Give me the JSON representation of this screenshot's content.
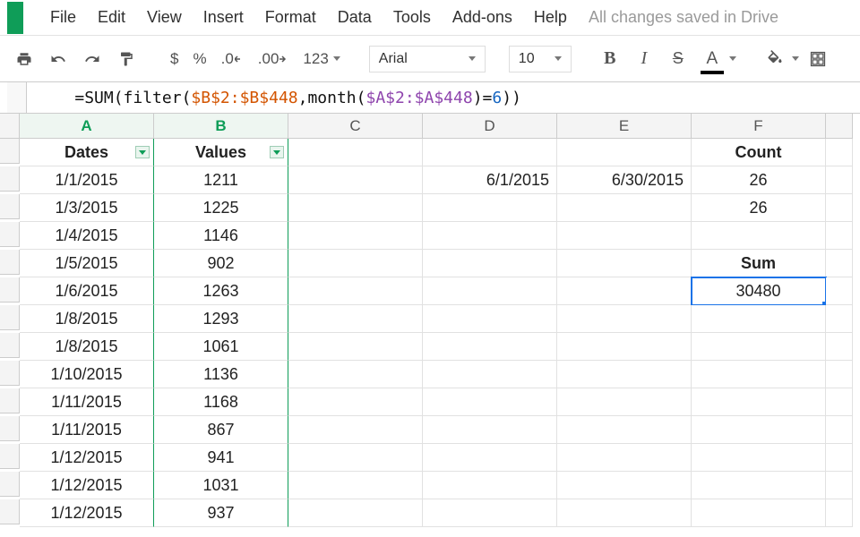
{
  "menu": [
    "File",
    "Edit",
    "View",
    "Insert",
    "Format",
    "Data",
    "Tools",
    "Add-ons",
    "Help"
  ],
  "save_status": "All changes saved in Drive",
  "toolbar": {
    "currency": "$",
    "percent": "%",
    "dec_dec": ".0",
    "inc_dec": ".00",
    "numfmt": "123",
    "font": "Arial",
    "size": "10",
    "bold": "B",
    "italic": "I",
    "strike": "S",
    "textcolor": "A"
  },
  "formula": {
    "prefix": "=SUM(filter(",
    "range1": "$B$2:$B$448",
    "mid": ",month(",
    "range2": "$A$2:$A$448",
    "mid2": ")=",
    "num": "6",
    "suffix": "))"
  },
  "columns": [
    "A",
    "B",
    "C",
    "D",
    "E",
    "F"
  ],
  "headers": {
    "A": "Dates",
    "B": "Values",
    "F": "Count"
  },
  "rows": [
    {
      "A": "1/1/2015",
      "B": "1211",
      "D": "6/1/2015",
      "E": "6/30/2015",
      "F": "26"
    },
    {
      "A": "1/3/2015",
      "B": "1225",
      "F": "26"
    },
    {
      "A": "1/4/2015",
      "B": "1146"
    },
    {
      "A": "1/5/2015",
      "B": "902",
      "F": "Sum",
      "F_bold": true
    },
    {
      "A": "1/6/2015",
      "B": "1263",
      "F": "30480",
      "F_selected": true
    },
    {
      "A": "1/8/2015",
      "B": "1293"
    },
    {
      "A": "1/8/2015",
      "B": "1061"
    },
    {
      "A": "1/10/2015",
      "B": "1136"
    },
    {
      "A": "1/11/2015",
      "B": "1168"
    },
    {
      "A": "1/11/2015",
      "B": "867"
    },
    {
      "A": "1/12/2015",
      "B": "941"
    },
    {
      "A": "1/12/2015",
      "B": "1031"
    },
    {
      "A": "1/12/2015",
      "B": "937"
    }
  ]
}
